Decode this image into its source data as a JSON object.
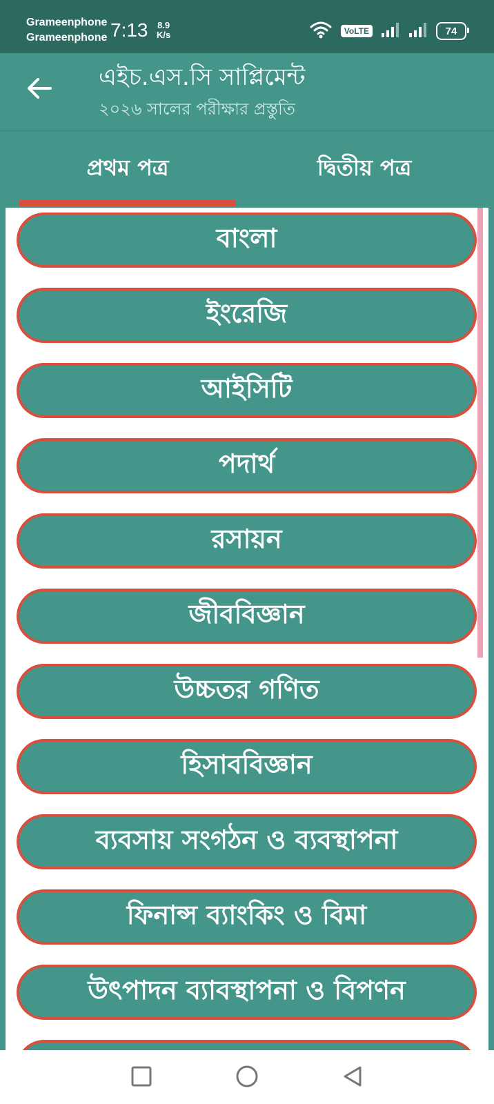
{
  "status_bar": {
    "carrier_1": "Grameenphone",
    "carrier_2": "Grameenphone",
    "time": "7:13",
    "speed_value": "8.9",
    "speed_unit": "K/s",
    "volte_label": "VoLTE",
    "battery_level": "74",
    "icons": [
      "wifi-icon",
      "volte-icon",
      "signal-icon",
      "signal-icon",
      "battery-icon"
    ]
  },
  "app_bar": {
    "title": "এইচ.এস.সি সাপ্লিমেন্ট",
    "subtitle": "২০২৬ সালের পরীক্ষার প্রস্তুতি",
    "back_icon": "arrow-left-icon"
  },
  "tabs": [
    {
      "label": "প্রথম পত্র",
      "selected": true
    },
    {
      "label": "দ্বিতীয় পত্র",
      "selected": false
    }
  ],
  "subjects": [
    {
      "label": "বাংলা"
    },
    {
      "label": "ইংরেজি"
    },
    {
      "label": "আইসিটি"
    },
    {
      "label": "পদার্থ"
    },
    {
      "label": "রসায়ন"
    },
    {
      "label": "জীববিজ্ঞান"
    },
    {
      "label": "উচ্চতর গণিত"
    },
    {
      "label": "হিসাববিজ্ঞান"
    },
    {
      "label": "ব্যবসায় সংগঠন ও ব্যবস্থাপনা"
    },
    {
      "label": "ফিনান্স ব্যাংকিং ও বিমা"
    },
    {
      "label": "উৎপাদন ব্যাবস্থাপনা ও বিপণন"
    },
    {
      "label": ""
    }
  ],
  "nav_bar": {
    "buttons": [
      "recents-square-icon",
      "home-circle-icon",
      "back-triangle-icon"
    ]
  },
  "colors": {
    "primary": "#44968a",
    "status_bar": "#2c6a5f",
    "accent": "#d84f3e",
    "scrollbar": "#eda1b5"
  }
}
